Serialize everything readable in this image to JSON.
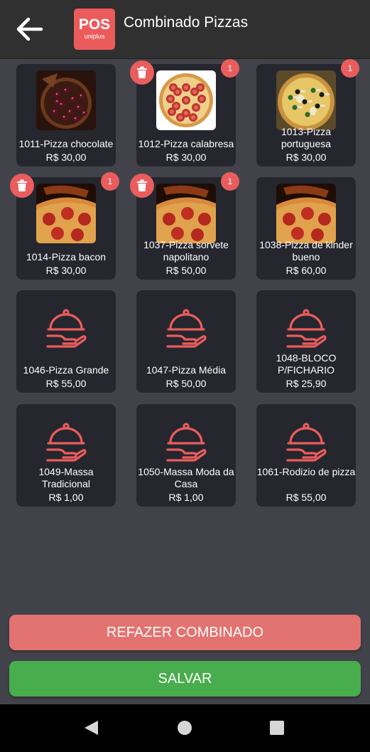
{
  "header": {
    "title": "Combinado Pizzas",
    "logo_text": "POS",
    "logo_sub": "uniplus"
  },
  "products": [
    {
      "name": "1011-Pizza chocolate",
      "price": "R$ 30,00",
      "badge": "",
      "kind": "photo-chocolate",
      "selected": false
    },
    {
      "name": "1012-Pizza calabresa",
      "price": "R$ 30,00",
      "badge": "1",
      "kind": "photo-calabresa",
      "selected": true
    },
    {
      "name": "1013-Pizza portuguesa",
      "price": "R$ 30,00",
      "badge": "1",
      "kind": "photo-portuguesa",
      "selected": false
    },
    {
      "name": "1014-Pizza bacon",
      "price": "R$ 30,00",
      "badge": "1",
      "kind": "photo-bacon",
      "selected": true
    },
    {
      "name": "1037-Pizza sorvete napolitano",
      "price": "R$ 50,00",
      "badge": "1",
      "kind": "photo-bacon",
      "selected": true
    },
    {
      "name": "1038-Pizza de kinder bueno",
      "price": "R$ 60,00",
      "badge": "",
      "kind": "photo-bacon",
      "selected": false
    },
    {
      "name": "1046-Pizza Grande",
      "price": "R$ 55,00",
      "badge": "",
      "kind": "cloche",
      "selected": false
    },
    {
      "name": "1047-Pizza Média",
      "price": "R$ 50,00",
      "badge": "",
      "kind": "cloche",
      "selected": false
    },
    {
      "name": "1048-BLOCO P/FICHARIO",
      "price": "R$ 25,90",
      "badge": "",
      "kind": "cloche",
      "selected": false
    },
    {
      "name": "1049-Massa Tradicional",
      "price": "R$ 1,00",
      "badge": "",
      "kind": "cloche",
      "selected": false
    },
    {
      "name": "1050-Massa Moda da Casa",
      "price": "R$ 1,00",
      "badge": "",
      "kind": "cloche",
      "selected": false
    },
    {
      "name": "1061-Rodizio de pizza",
      "price": "R$ 55,00",
      "badge": "",
      "kind": "cloche",
      "selected": false
    }
  ],
  "buttons": {
    "redo": "REFAZER COMBINADO",
    "save": "SALVAR"
  },
  "colors": {
    "accent": "#ea5d5d",
    "save": "#48ad4c",
    "tile": "#25262e",
    "background": "#42434a"
  }
}
